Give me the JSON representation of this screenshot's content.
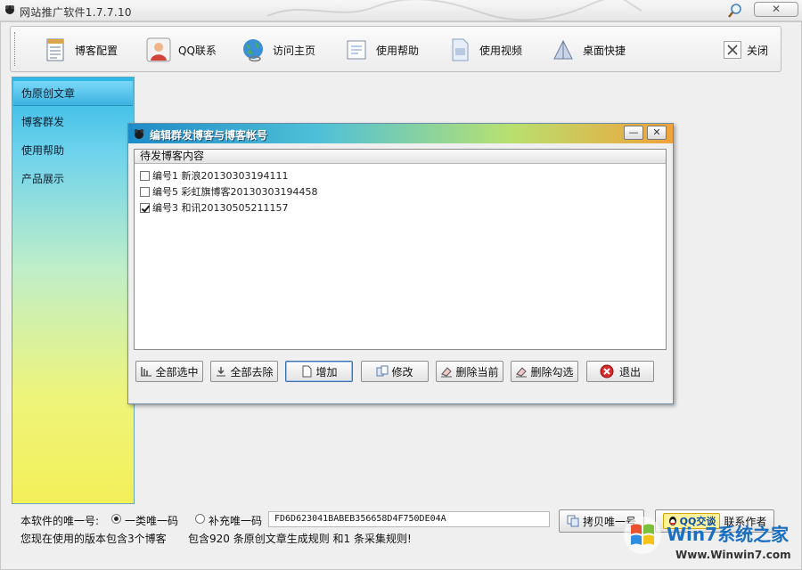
{
  "window": {
    "title": "网站推广软件1.7.7.10"
  },
  "toolbar": {
    "items": [
      {
        "label": "博客配置",
        "icon": "document-list-icon"
      },
      {
        "label": "QQ联系",
        "icon": "user-avatar-icon"
      },
      {
        "label": "访问主页",
        "icon": "globe-icon"
      },
      {
        "label": "使用帮助",
        "icon": "help-document-icon"
      },
      {
        "label": "使用视频",
        "icon": "video-file-icon"
      },
      {
        "label": "桌面快捷",
        "icon": "shortcut-icon"
      },
      {
        "label": "关闭",
        "icon": "close-icon"
      }
    ]
  },
  "sidebar": {
    "items": [
      {
        "label": "伪原创文章",
        "active": true
      },
      {
        "label": "博客群发",
        "active": false
      },
      {
        "label": "使用帮助",
        "active": false
      },
      {
        "label": "产品展示",
        "active": false
      }
    ]
  },
  "dialog": {
    "title": "编辑群发博客与博客帐号",
    "minimize_label": "—",
    "close_label": "✕",
    "list_header": "待发博客内容",
    "rows": [
      {
        "label": "编号1 新浪20130303194111",
        "checked": false
      },
      {
        "label": "编号5 彩虹旗博客20130303194458",
        "checked": false
      },
      {
        "label": "编号3 和讯20130505211157",
        "checked": true
      }
    ],
    "buttons": {
      "select_all": "全部选中",
      "deselect_all": "全部去除",
      "add": "增加",
      "edit": "修改",
      "delete_current": "删除当前",
      "delete_checked": "删除勾选",
      "exit": "退出"
    }
  },
  "bottom": {
    "unique_code_label": "本软件的唯一号:",
    "radio_primary": "一类唯一码",
    "radio_secondary": "补充唯一码",
    "unique_code_value": "FD6D623041BABEB356658D4F750DE04A",
    "copy_button": "拷贝唯一号",
    "qq_badge": "QQ交谈",
    "contact_label": "联系作者",
    "version_info": "您现在使用的版本包含3个博客",
    "rules_info": "包含920 条原创文章生成规则 和1 条采集规则!"
  },
  "watermark": {
    "title": "Win7系统之家",
    "url": "Www.Winwin7.com"
  },
  "colors": {
    "accent": "#2eb8e6",
    "dialog_title": "#1f8bc7"
  }
}
